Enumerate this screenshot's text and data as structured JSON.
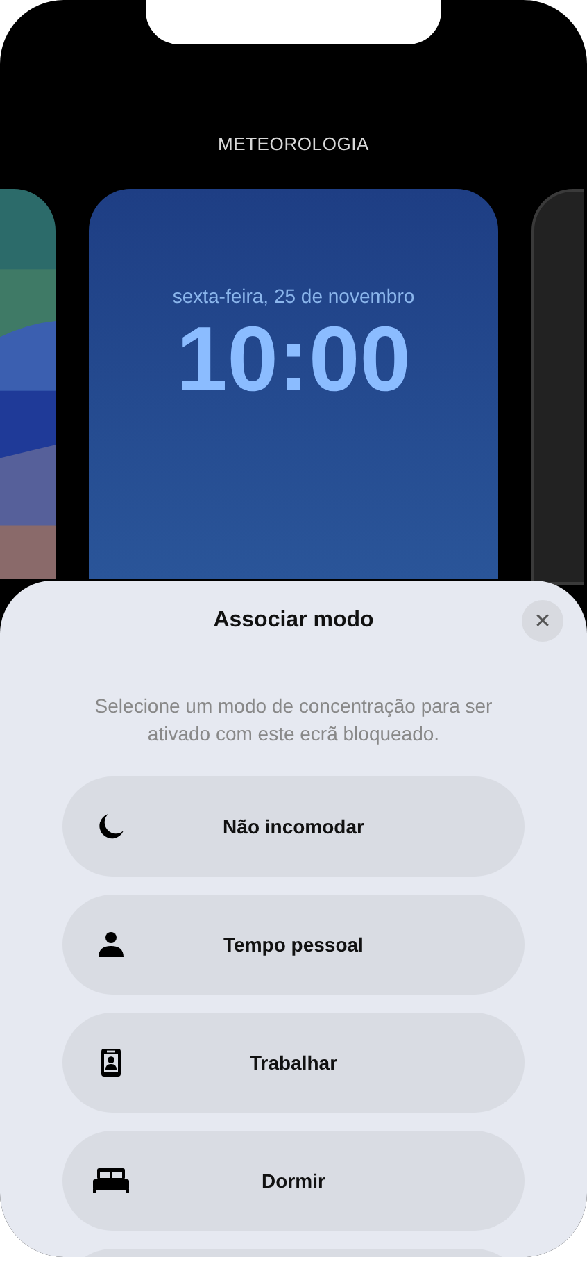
{
  "header": {
    "title": "METEOROLOGIA"
  },
  "lock_screen": {
    "date": "sexta-feira, 25 de novembro",
    "time": "10:00"
  },
  "sheet": {
    "title": "Associar modo",
    "close": "✕",
    "description": "Selecione um modo de concentração para ser ativado com este ecrã bloqueado.",
    "modes": [
      {
        "kind": "moon",
        "label": "Não incomodar"
      },
      {
        "kind": "person",
        "label": "Tempo pessoal"
      },
      {
        "kind": "badge",
        "label": "Trabalhar"
      },
      {
        "kind": "bed",
        "label": "Dormir"
      }
    ]
  }
}
